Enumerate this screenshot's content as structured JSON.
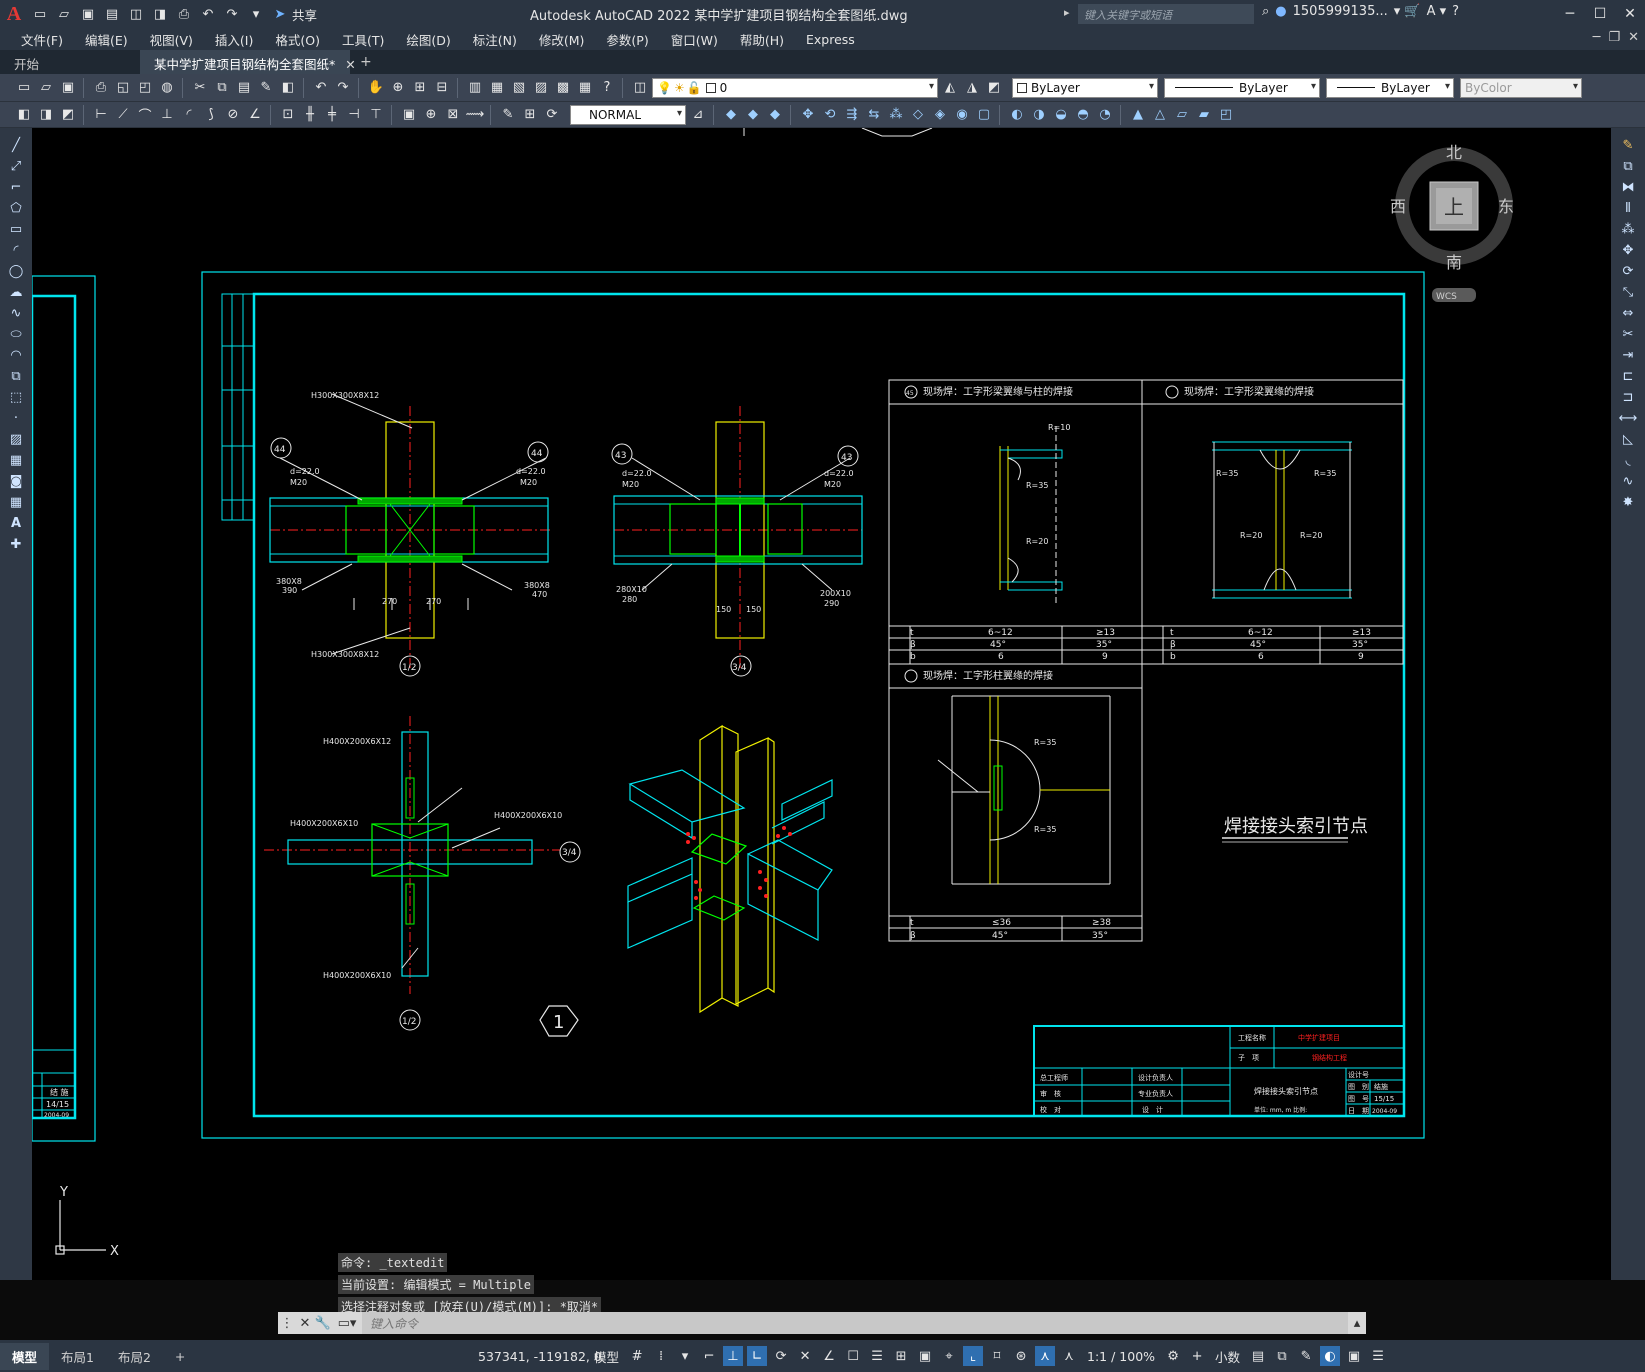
{
  "titlebar": {
    "app_letter": "A",
    "title": "Autodesk AutoCAD 2022    某中学扩建项目钢结构全套图纸.dwg",
    "share_label": "共享",
    "search_placeholder": "键入关键字或短语",
    "username": "1505999135..."
  },
  "menu": {
    "items": [
      "文件(F)",
      "编辑(E)",
      "视图(V)",
      "插入(I)",
      "格式(O)",
      "工具(T)",
      "绘图(D)",
      "标注(N)",
      "修改(M)",
      "参数(P)",
      "窗口(W)",
      "帮助(H)",
      "Express"
    ]
  },
  "tabs": {
    "start": "开始",
    "active": "某中学扩建项目钢结构全套图纸*"
  },
  "toolbar": {
    "layer_value": "0",
    "color_value": "ByLayer",
    "linetype_value": "ByLayer",
    "lineweight_value": "ByLayer",
    "plotstyle_value": "ByColor",
    "text_style": "NORMAL"
  },
  "viewcube": {
    "north": "北",
    "south": "南",
    "east": "东",
    "west": "西",
    "top_face": "上",
    "wcs": "WCS"
  },
  "drawing": {
    "title": "焊接接头索引节点",
    "labels": {
      "h300": "H300X300X8X12",
      "h400_top": "H400X200X6X12",
      "h400_left": "H400X200X6X10",
      "h400_right": "H400X200X6X10",
      "h400_bottom": "H400X200X6X10",
      "sec_12": "1/2",
      "sec_34": "3/4",
      "node_1": "1",
      "bolt_d": "d=22.0",
      "bolt_m": "M20",
      "plate_left_1": "380X8",
      "plate_left_1b": "390",
      "plate_right_1": "380X8",
      "plate_right_1b": "470",
      "plate_left_2": "280X10",
      "plate_left_2b": "280",
      "plate_right_2": "200X10",
      "plate_right_2b": "290",
      "dim_270": "270",
      "dim_150": "150",
      "tag_44": "44",
      "tag_43": "43",
      "tag_45": "45",
      "weld_45_title": "现场焊：工字形梁翼缘与柱的焊接",
      "weld_44_title": "现场焊：工字形梁翼缘的焊接",
      "weld_46_title": "现场焊：工字形柱翼缘的焊接",
      "r10": "R=10",
      "r35": "R=35",
      "r20": "R=20",
      "t": "t",
      "beta": "β",
      "b": "b",
      "t_range_1": "6~12",
      "t_range_2": "≥13",
      "deg45": "45°",
      "deg35": "35°",
      "b6": "6",
      "b9": "9",
      "t_le36": "≤36",
      "t_ge38": "≥38"
    },
    "title_block": {
      "project_label": "工程名称",
      "project_value": "中学扩建项目",
      "item_label": "子　项",
      "item_value": "钢结构工程",
      "drawing_name": "焊接接头索引节点",
      "unit_note": "单位: mm, m  比例:",
      "role_chief": "总工程师",
      "role_review": "审　核",
      "role_check": "校　对",
      "role_lead": "设计负责人",
      "role_prof": "专业负责人",
      "role_design": "设　计",
      "design_no_label": "设计号",
      "cat_label": "图　别",
      "cat_value": "结施",
      "no_label": "图　号",
      "no_value": "15/15",
      "date_label": "日　期",
      "date_value": "2004-09"
    },
    "left_sheet": {
      "cat_value": "结 施",
      "no_value": "14/15",
      "date_value": "2004-09"
    }
  },
  "command": {
    "line1": "命令: _textedit",
    "line2": "当前设置: 编辑模式 = Multiple",
    "line3": "选择注释对象或 [放弃(U)/模式(M)]: *取消*",
    "placeholder": "键入命令"
  },
  "status": {
    "layouts": [
      "模型",
      "布局1",
      "布局2"
    ],
    "coords": "537341, -119182, 0",
    "model_label": "模型",
    "scale": "1:1 / 100%",
    "units": "小数"
  },
  "colors": {
    "cyan": "#00e5ee",
    "yellow": "#f0f000",
    "green": "#00ff00",
    "red": "#ff2020",
    "white": "#e8e8e8"
  }
}
